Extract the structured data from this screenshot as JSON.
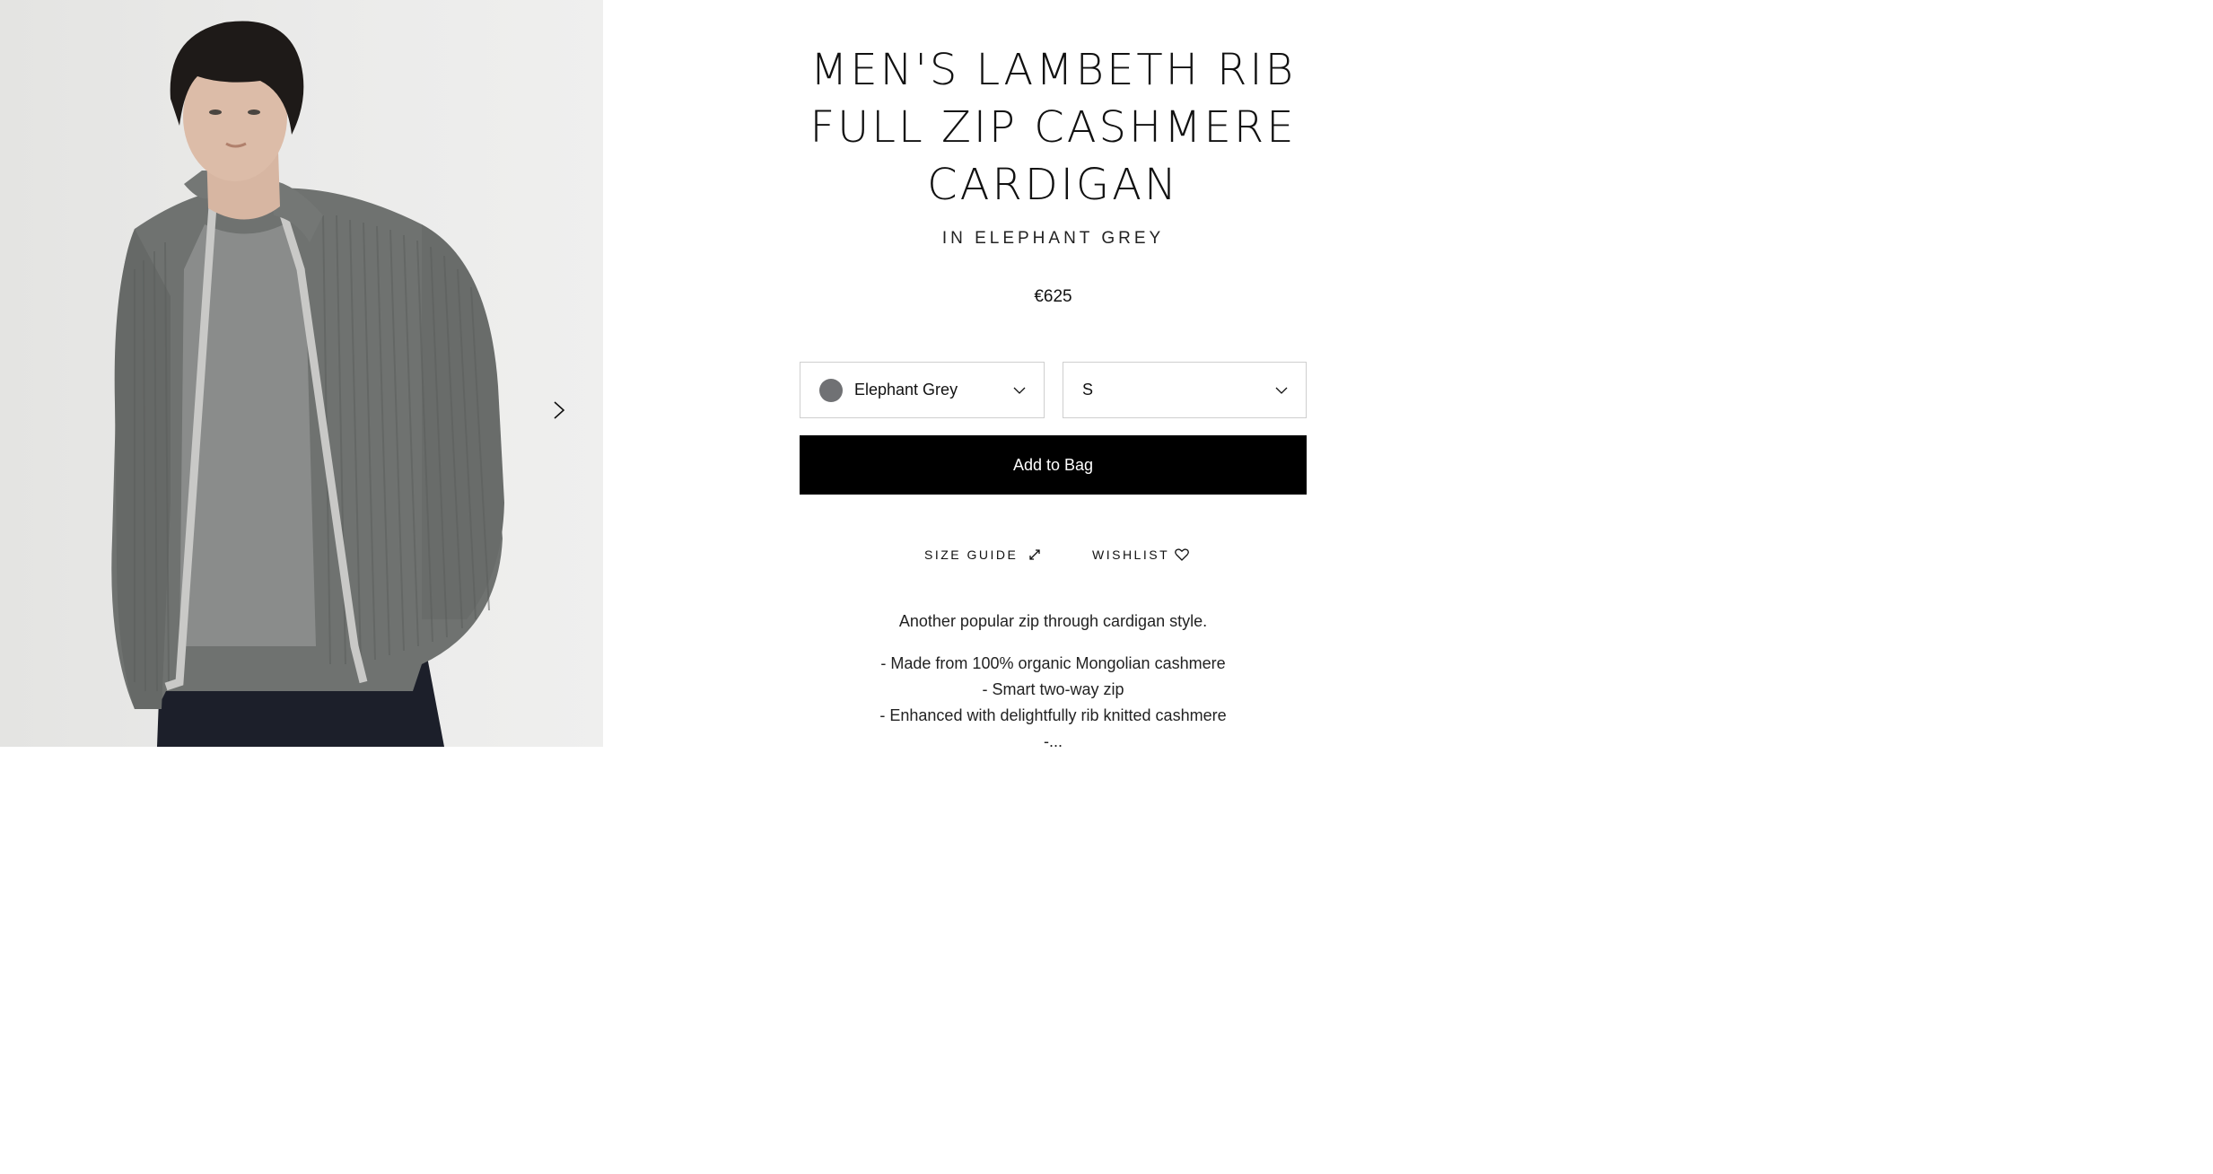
{
  "gallery": {
    "next_icon": "chevron-right-icon"
  },
  "product": {
    "title": "MEN'S LAMBETH RIB FULL ZIP CASHMERE CARDIGAN",
    "subtitle": "IN ELEPHANT GREY",
    "price": "€625"
  },
  "selectors": {
    "colour": {
      "value": "Elephant Grey",
      "swatch_color": "#707174",
      "icon": "chevron-down-icon"
    },
    "size": {
      "value": "S",
      "icon": "chevron-down-icon"
    }
  },
  "actions": {
    "add_to_bag": "Add to Bag",
    "size_guide": "SIZE GUIDE",
    "size_guide_icon": "expand-arrows-icon",
    "wishlist": "WISHLIST",
    "wishlist_icon": "heart-icon"
  },
  "description": {
    "lead": "Another popular zip through cardigan style.",
    "bullets": [
      "- Made from 100% organic Mongolian cashmere",
      "- Smart two-way zip",
      "- Enhanced with delightfully rib knitted cashmere",
      "-..."
    ]
  },
  "colors": {
    "button_bg": "#000000",
    "button_text": "#ffffff",
    "border": "#cfcfcf"
  }
}
